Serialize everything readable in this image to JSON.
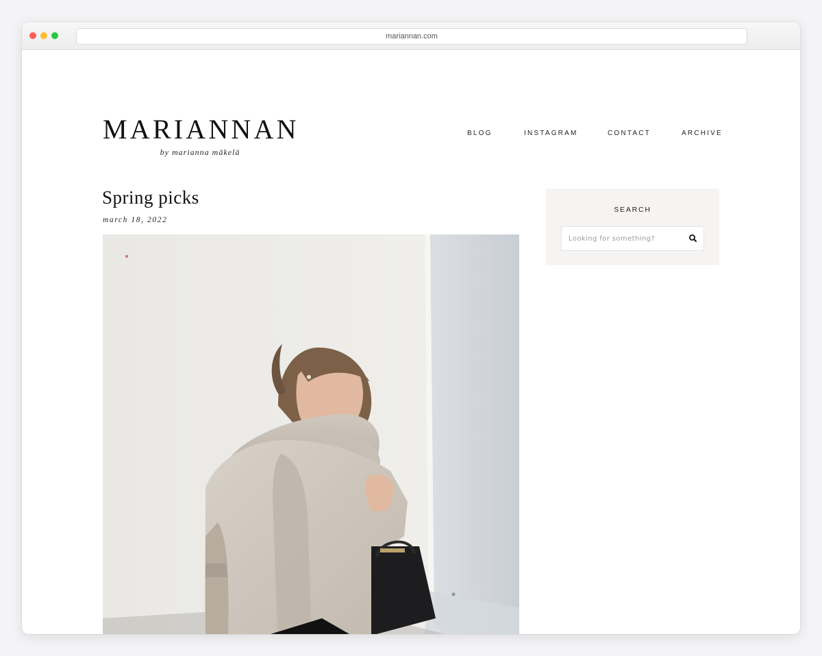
{
  "browser": {
    "url": "mariannan.com"
  },
  "site": {
    "logo": "MARIANNAN",
    "tagline": "by marianna mäkelä"
  },
  "nav": {
    "items": [
      "BLOG",
      "INSTAGRAM",
      "CONTACT",
      "ARCHIVE"
    ]
  },
  "post": {
    "title": "Spring picks",
    "date": "march 18, 2022"
  },
  "sidebar": {
    "search_title": "SEARCH",
    "search_placeholder": "Looking for something?",
    "search_icon": "search-icon"
  },
  "colors": {
    "sidebar_bg": "#f5f4f2",
    "text": "#111111",
    "traffic_red": "#fe5f57",
    "traffic_yellow": "#febc2e",
    "traffic_green": "#28c840"
  }
}
